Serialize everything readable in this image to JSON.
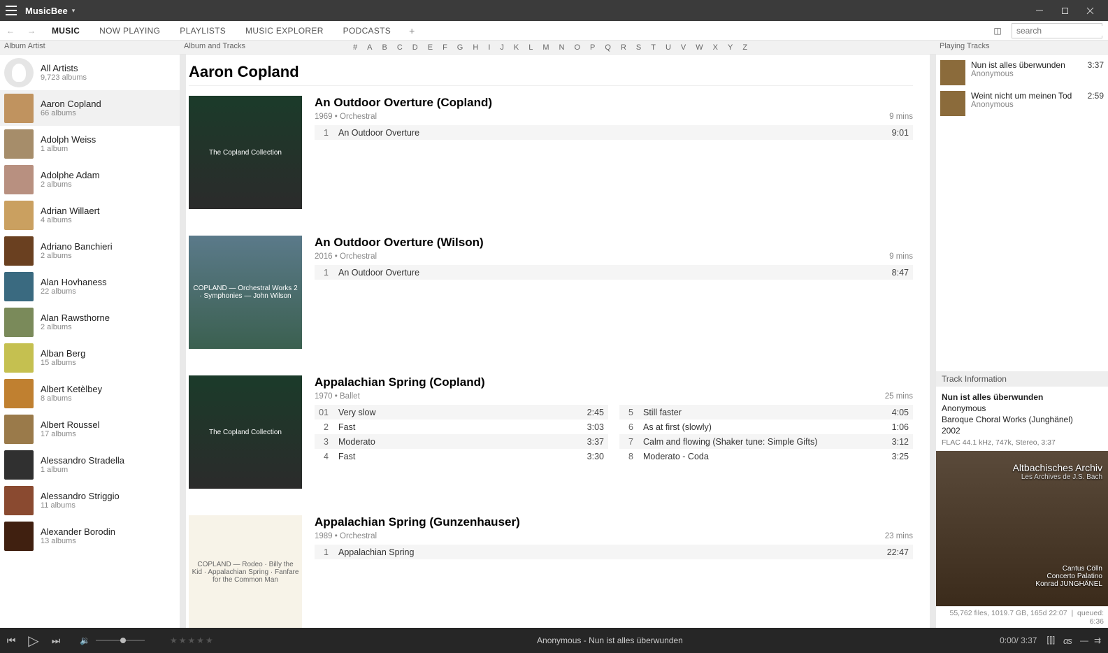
{
  "app": {
    "title": "MusicBee"
  },
  "window_controls": {
    "minimize": "–",
    "maximize": "◻",
    "close": "✕"
  },
  "nav": {
    "tabs": [
      "MUSIC",
      "NOW PLAYING",
      "PLAYLISTS",
      "MUSIC EXPLORER",
      "PODCASTS"
    ],
    "active_index": 0,
    "plus": "+",
    "search_placeholder": "search"
  },
  "column_headers": {
    "left": "Album Artist",
    "mid": "Album and Tracks",
    "right": "Playing Tracks"
  },
  "alpha_index": [
    "#",
    "A",
    "B",
    "C",
    "D",
    "E",
    "F",
    "G",
    "H",
    "I",
    "J",
    "K",
    "L",
    "M",
    "N",
    "O",
    "P",
    "Q",
    "R",
    "S",
    "T",
    "U",
    "V",
    "W",
    "X",
    "Y",
    "Z"
  ],
  "artists": [
    {
      "name": "All Artists",
      "sub": "9,723 albums",
      "blank": true
    },
    {
      "name": "Aaron Copland",
      "sub": "66 albums",
      "active": true
    },
    {
      "name": "Adolph Weiss",
      "sub": "1 album"
    },
    {
      "name": "Adolphe Adam",
      "sub": "2 albums"
    },
    {
      "name": "Adrian Willaert",
      "sub": "4 albums"
    },
    {
      "name": "Adriano Banchieri",
      "sub": "2 albums"
    },
    {
      "name": "Alan Hovhaness",
      "sub": "22 albums"
    },
    {
      "name": "Alan Rawsthorne",
      "sub": "2 albums"
    },
    {
      "name": "Alban Berg",
      "sub": "15 albums"
    },
    {
      "name": "Albert Ketèlbey",
      "sub": "8 albums"
    },
    {
      "name": "Albert Roussel",
      "sub": "17 albums"
    },
    {
      "name": "Alessandro Stradella",
      "sub": "1 album"
    },
    {
      "name": "Alessandro Striggio",
      "sub": "11 albums"
    },
    {
      "name": "Alexander Borodin",
      "sub": "13 albums"
    }
  ],
  "current_artist": "Aaron Copland",
  "albums": [
    {
      "title": "An Outdoor Overture (Copland)",
      "art_class": "copland",
      "art_stub": "The Copland Collection",
      "year": "1969",
      "genre": "Orchestral",
      "length": "9 mins",
      "cols": [
        [
          {
            "n": "1",
            "name": "An Outdoor Overture",
            "dur": "9:01"
          }
        ]
      ]
    },
    {
      "title": "An Outdoor Overture (Wilson)",
      "art_class": "wilson",
      "art_stub": "COPLAND — Orchestral Works 2 · Symphonies — John Wilson",
      "year": "2016",
      "genre": "Orchestral",
      "length": "9 mins",
      "cols": [
        [
          {
            "n": "1",
            "name": "An Outdoor Overture",
            "dur": "8:47"
          }
        ]
      ]
    },
    {
      "title": "Appalachian Spring (Copland)",
      "art_class": "copland",
      "art_stub": "The Copland Collection",
      "year": "1970",
      "genre": "Ballet",
      "length": "25 mins",
      "cols": [
        [
          {
            "n": "01",
            "name": "Very slow",
            "dur": "2:45"
          },
          {
            "n": "2",
            "name": "Fast",
            "dur": "3:03"
          },
          {
            "n": "3",
            "name": "Moderato",
            "dur": "3:37"
          },
          {
            "n": "4",
            "name": "Fast",
            "dur": "3:30"
          }
        ],
        [
          {
            "n": "5",
            "name": "Still faster",
            "dur": "4:05"
          },
          {
            "n": "6",
            "name": "As at first (slowly)",
            "dur": "1:06"
          },
          {
            "n": "7",
            "name": "Calm and flowing (Shaker tune: Simple Gifts)",
            "dur": "3:12"
          },
          {
            "n": "8",
            "name": "Moderato - Coda",
            "dur": "3:25"
          }
        ]
      ]
    },
    {
      "title": "Appalachian Spring (Gunzenhauser)",
      "art_class": "white",
      "art_stub": "COPLAND — Rodeo · Billy the Kid · Appalachian Spring · Fanfare for the Common Man",
      "year": "1989",
      "genre": "Orchestral",
      "length": "23 mins",
      "cols": [
        [
          {
            "n": "1",
            "name": "Appalachian Spring",
            "dur": "22:47"
          }
        ]
      ]
    }
  ],
  "playing_tracks": [
    {
      "title": "Nun ist alles überwunden",
      "artist": "Anonymous",
      "dur": "3:37"
    },
    {
      "title": "Weint nicht um meinen Tod",
      "artist": "Anonymous",
      "dur": "2:59"
    }
  ],
  "track_info": {
    "header": "Track Information",
    "title": "Nun ist alles überwunden",
    "artist": "Anonymous",
    "album": "Baroque Choral Works (Junghänel)",
    "year": "2002",
    "tech": "FLAC 44.1 kHz, 747k, Stereo, 3:37"
  },
  "big_art": {
    "line1": "Altbachisches Archiv",
    "line2": "Les Archives de J.S. Bach",
    "line3": "Cantus Cölln",
    "line4": "Concerto Palatino",
    "line5": "Konrad JUNGHÄNEL"
  },
  "stats": {
    "files": "55,762 files, 1019.7 GB, 165d 22:07",
    "queued": "queued: 6:36"
  },
  "player": {
    "stars": "★★★★★",
    "now_playing": "Anonymous - Nun ist alles überwunden",
    "time": "0:00/ 3:37",
    "lastfm": "αs"
  }
}
